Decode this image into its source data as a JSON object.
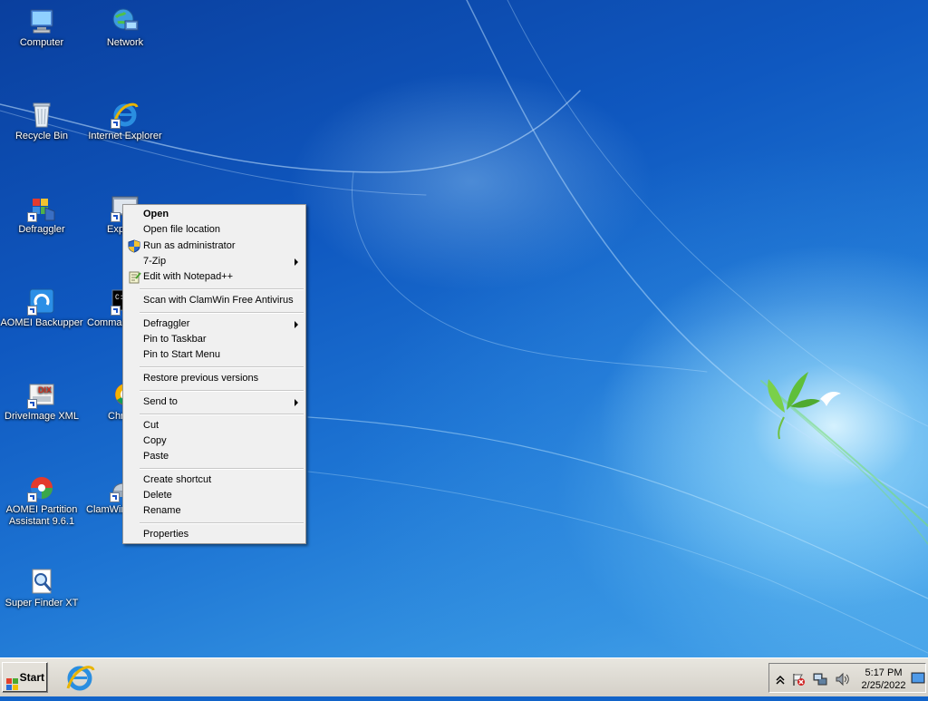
{
  "desktop": {
    "icons": [
      {
        "label": "Computer"
      },
      {
        "label": "Network"
      },
      {
        "label": "Recycle Bin"
      },
      {
        "label": "Internet Explorer"
      },
      {
        "label": "Defraggler"
      },
      {
        "label": "Exp"
      },
      {
        "label": "AOMEI Backupper"
      },
      {
        "label": "Comman"
      },
      {
        "label": "DriveImage XML"
      },
      {
        "label": "Chr"
      },
      {
        "label": "AOMEI Partition\nAssistant 9.6.1"
      },
      {
        "label": "ClamWin"
      },
      {
        "label": "Super Finder XT"
      }
    ]
  },
  "context_menu": {
    "items": [
      {
        "label": "Open",
        "bold": true
      },
      {
        "label": "Open file location"
      },
      {
        "label": "Run as administrator",
        "icon": "uac-shield-icon"
      },
      {
        "label": "7-Zip",
        "submenu": true
      },
      {
        "label": "Edit with Notepad++",
        "icon": "notepadpp-icon"
      },
      {
        "label": "Scan with ClamWin Free Antivirus"
      },
      {
        "label": "Defraggler",
        "submenu": true
      },
      {
        "label": "Pin to Taskbar"
      },
      {
        "label": "Pin to Start Menu"
      },
      {
        "label": "Restore previous versions"
      },
      {
        "label": "Send to",
        "submenu": true
      },
      {
        "label": "Cut"
      },
      {
        "label": "Copy"
      },
      {
        "label": "Paste"
      },
      {
        "label": "Create shortcut"
      },
      {
        "label": "Delete"
      },
      {
        "label": "Rename"
      },
      {
        "label": "Properties"
      }
    ]
  },
  "taskbar": {
    "start_label": "Start",
    "pinned": [
      "internet-explorer-icon"
    ],
    "tray_icons": [
      "show-hidden-icons-chevron",
      "action-center-flag-icon",
      "network-icon",
      "volume-icon"
    ],
    "clock_time": "5:17 PM",
    "clock_date": "2/25/2022"
  },
  "colors": {
    "desktop_blue": "#1163c9",
    "menu_bg": "#f0f0f0",
    "taskbar_bg": "#d4d0c8"
  }
}
